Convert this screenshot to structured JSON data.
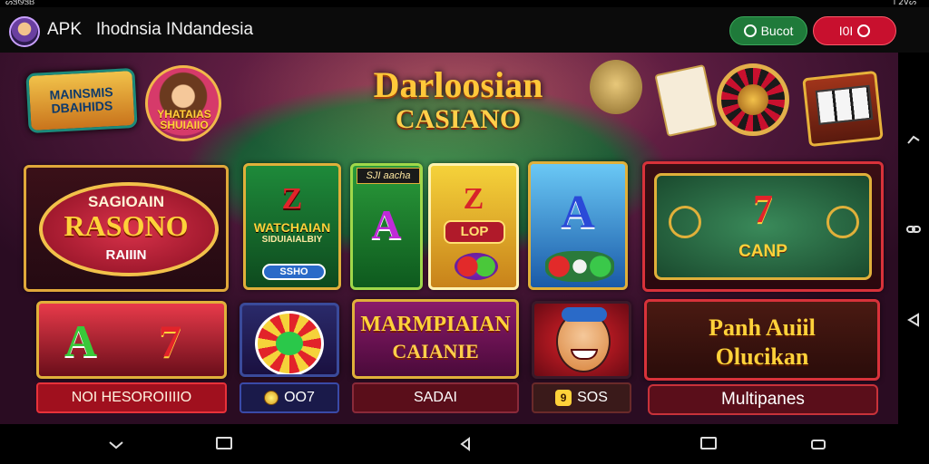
{
  "status": {
    "left": "ᔕᏕᏫᏕᏴ",
    "right": "I 2ᐯᔕ"
  },
  "header": {
    "title": "APK   Ihodnsia INdandesia",
    "search_label": "Bucot",
    "close_label": "I0I"
  },
  "banner": {
    "left_logo": "MAINSMIS DBAIHIDS",
    "hostess_label": "YHATAIAS SHUIAIIO",
    "title_line1": "Darloosian",
    "title_line2": "CASIANO"
  },
  "tiles": {
    "rasono": {
      "l1": "SAGIOAIN",
      "l2": "RASONO",
      "l3": "RAIIIN"
    },
    "wat": {
      "big": "Z",
      "l1": "WATCHAIAN",
      "l2": "SIDUIAIALBIY",
      "pill": "SSHO"
    },
    "a1": {
      "tag": "SJI aacha",
      "big": "A"
    },
    "lop": {
      "big": "Z",
      "badge": "LOP"
    },
    "a2": {
      "big": "A"
    },
    "camp": {
      "big": "7",
      "label": "CANP"
    },
    "a7": {
      "a": "A",
      "s": "7",
      "label": "NOI HESOROIIIIO"
    },
    "wheel": {
      "label": "OO7"
    },
    "marm": {
      "l1": "MARMPIAIAN",
      "l2": "CAIANIE",
      "label": "SADAI"
    },
    "clown": {
      "chip": "9",
      "label": "SOS"
    },
    "park": {
      "l1": "Panh Auiil",
      "l2": "Olucikan",
      "label": "Multipanes"
    }
  },
  "icons": {
    "rail": [
      "arrow-icon",
      "link-icon",
      "back-triangle-icon"
    ],
    "nav": [
      "back-icon",
      "recent-icon",
      "home-icon",
      "recents-icon",
      "rotate-icon"
    ]
  }
}
